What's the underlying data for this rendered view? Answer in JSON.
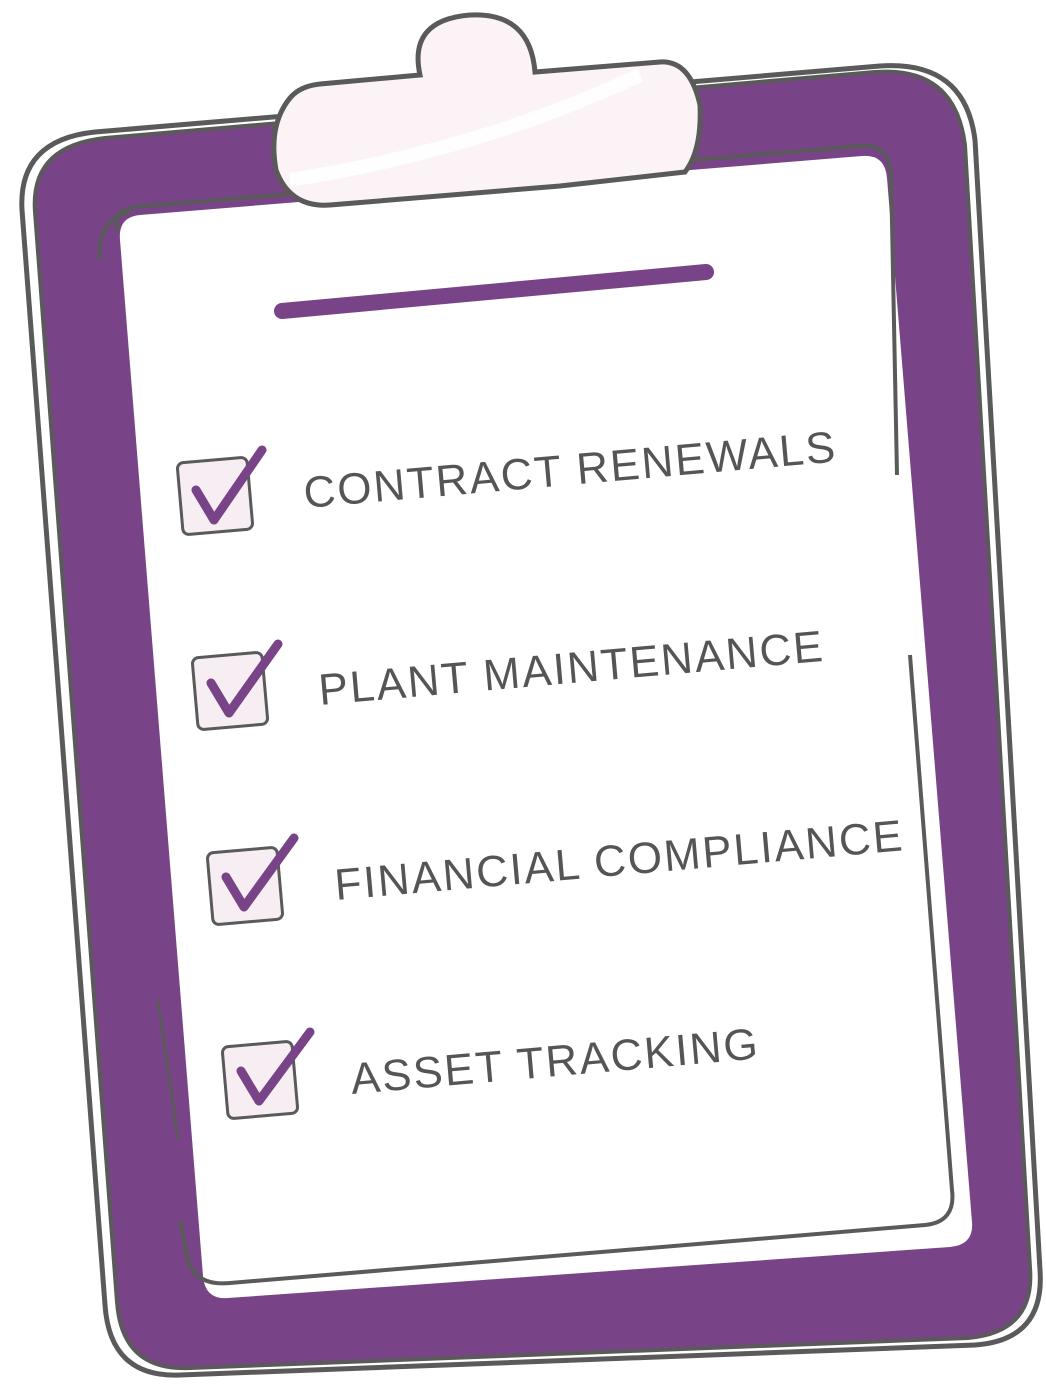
{
  "colors": {
    "board": "#784487",
    "outline": "#5a5a5a",
    "paper": "#ffffff",
    "clip": "#fbf3f6",
    "checkbox_fill": "#f7eef4",
    "check": "#784487",
    "text": "#555555"
  },
  "clipboard": {
    "items": [
      {
        "label": "CONTRACT RENEWALS",
        "checked": true,
        "icon": "checkmark-icon"
      },
      {
        "label": "PLANT MAINTENANCE",
        "checked": true,
        "icon": "checkmark-icon"
      },
      {
        "label": "FINANCIAL COMPLIANCE",
        "checked": true,
        "icon": "checkmark-icon"
      },
      {
        "label": "ASSET TRACKING",
        "checked": true,
        "icon": "checkmark-icon"
      }
    ]
  }
}
